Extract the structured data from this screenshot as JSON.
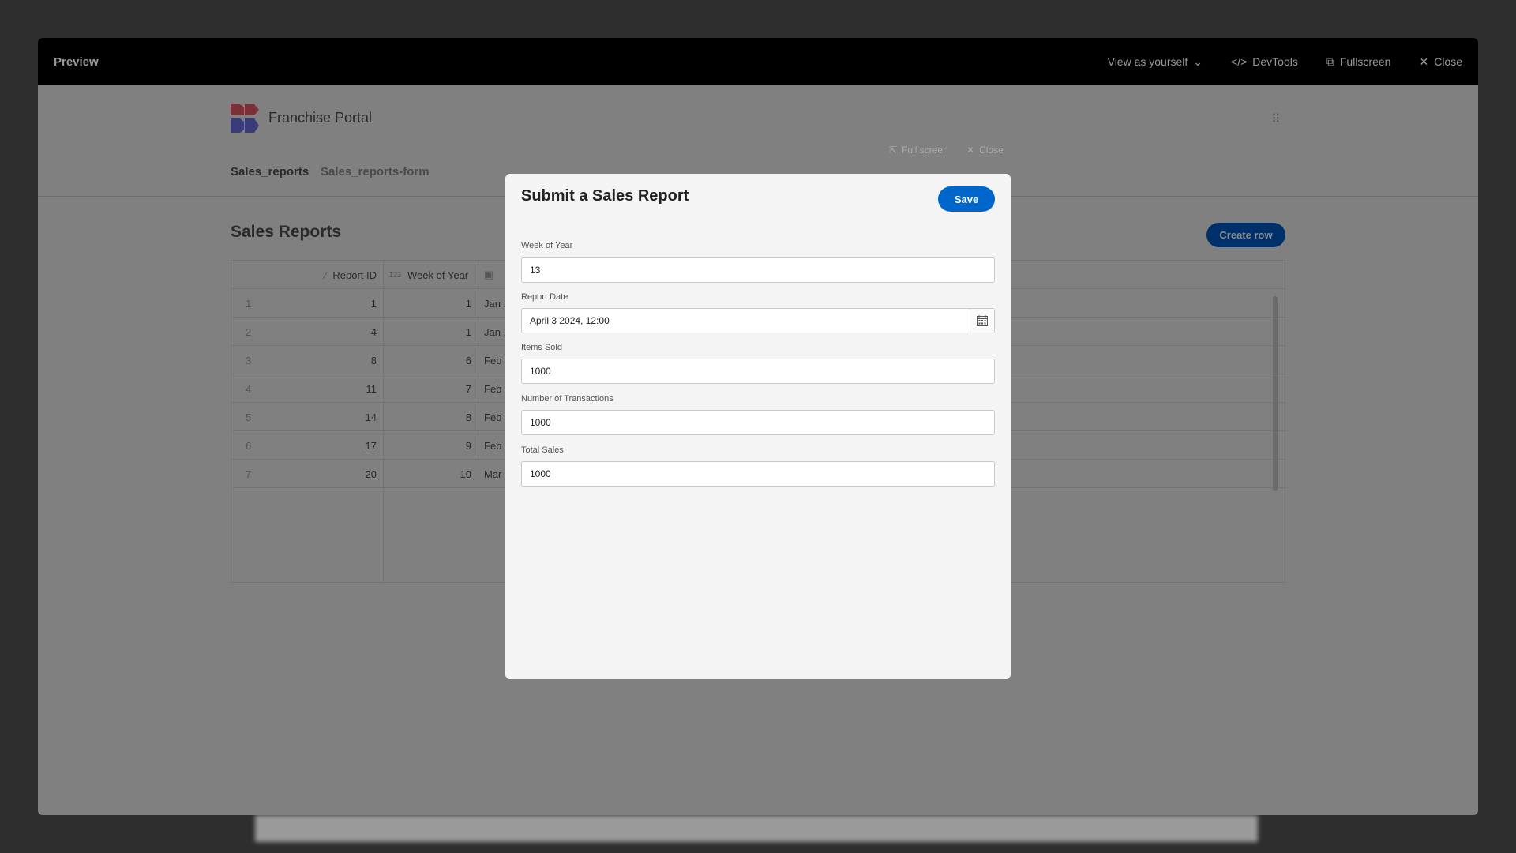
{
  "preview": {
    "title": "Preview",
    "view_as": "View as yourself",
    "devtools": "DevTools",
    "fullscreen": "Fullscreen",
    "close": "Close"
  },
  "app": {
    "name": "Franchise Portal",
    "fullscreen": "Full screen",
    "close": "Close",
    "tabs": [
      {
        "label": "Sales_reports",
        "active": true
      },
      {
        "label": "Sales_reports-form",
        "active": false
      }
    ],
    "heading": "Sales Reports",
    "create_row": "Create row"
  },
  "table": {
    "columns": [
      "Report ID",
      "Week of Year",
      ""
    ],
    "column_icons": [
      "magic-wand-icon",
      "number-type-icon",
      "calendar-icon"
    ],
    "rows": [
      {
        "n": "1",
        "id": "1",
        "week": "1",
        "date": "Jan 1"
      },
      {
        "n": "2",
        "id": "4",
        "week": "1",
        "date": "Jan 1"
      },
      {
        "n": "3",
        "id": "8",
        "week": "6",
        "date": "Feb 5"
      },
      {
        "n": "4",
        "id": "11",
        "week": "7",
        "date": "Feb 1"
      },
      {
        "n": "5",
        "id": "14",
        "week": "8",
        "date": "Feb 1"
      },
      {
        "n": "6",
        "id": "17",
        "week": "9",
        "date": "Feb 2"
      },
      {
        "n": "7",
        "id": "20",
        "week": "10",
        "date": "Mar 4"
      }
    ]
  },
  "modal": {
    "title": "Submit a Sales Report",
    "save": "Save",
    "fields": [
      {
        "label": "Week of Year",
        "value": "13"
      },
      {
        "label": "Report Date",
        "value": "April 3 2024, 12:00"
      },
      {
        "label": "Items Sold",
        "value": "1000"
      },
      {
        "label": "Number of Transactions",
        "value": "1000"
      },
      {
        "label": "Total Sales",
        "value": "1000"
      }
    ]
  },
  "colors": {
    "primary": "#0066cc",
    "header": "#000000"
  }
}
